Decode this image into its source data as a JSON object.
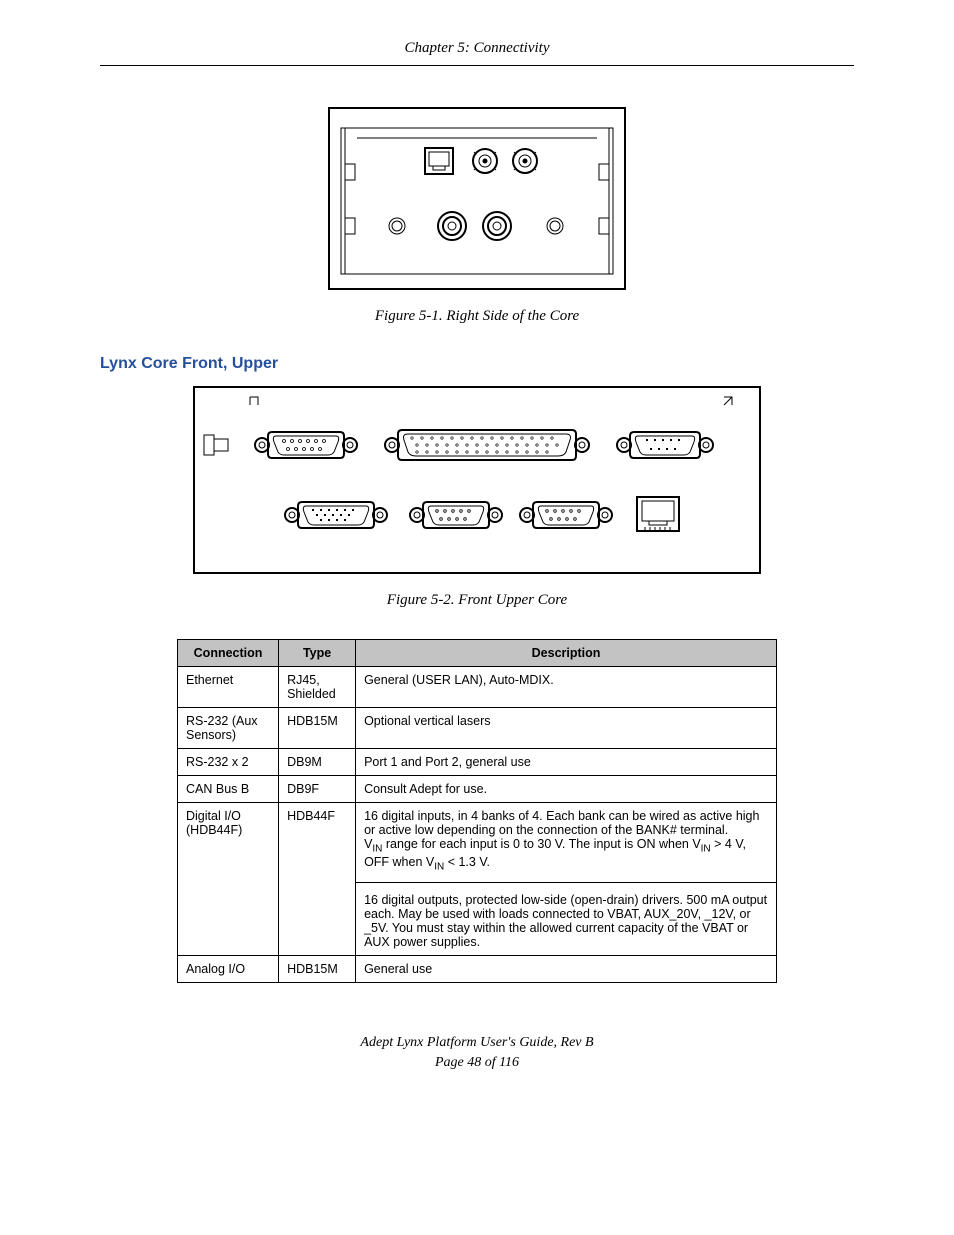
{
  "chapter_header": "Chapter 5: Connectivity",
  "figure1_caption": "Figure 5-1. Right Side of the Core",
  "section_heading": "Lynx Core Front, Upper",
  "figure2_caption": "Figure 5-2. Front Upper Core",
  "table": {
    "headers": {
      "c1": "Connection",
      "c2": "Type",
      "c3": "Description"
    },
    "rows": [
      {
        "c1": "Ethernet",
        "c2": "RJ45, Shielded",
        "c3": "General (USER LAN), Auto-MDIX."
      },
      {
        "c1": "RS-232 (Aux Sensors)",
        "c2": "HDB15M",
        "c3": "Optional vertical lasers"
      },
      {
        "c1": "RS-232 x 2",
        "c2": "DB9M",
        "c3": "Port 1 and Port 2, general use"
      },
      {
        "c1": "CAN Bus B",
        "c2": "DB9F",
        "c3": "Consult Adept for use."
      },
      {
        "c1": "Digital I/O (HDB44F)",
        "c2": "HDB44F",
        "c3a_1": "16 digital inputs, in 4 banks of 4. Each bank can be wired as active high or active low depending on the connection of the BANK# terminal.",
        "c3a_2a": "V",
        "c3a_2b": " range for each input is 0 to 30 V. The input is ON when V",
        "c3a_2c": " > 4 V, OFF when V",
        "c3a_2d": " < 1.3 V.",
        "c3b": "16 digital outputs, protected low-side (open-drain) drivers. 500 mA output each. May be used with loads connected to VBAT, AUX_20V, _12V, or _5V. You must stay within the allowed current capacity of the VBAT or AUX power supplies."
      },
      {
        "c1": "Analog I/O",
        "c2": "HDB15M",
        "c3": "General use"
      }
    ],
    "subscript": "IN"
  },
  "footer": {
    "line1": "Adept Lynx Platform User's Guide, Rev B",
    "line2": "Page 48 of 116"
  }
}
